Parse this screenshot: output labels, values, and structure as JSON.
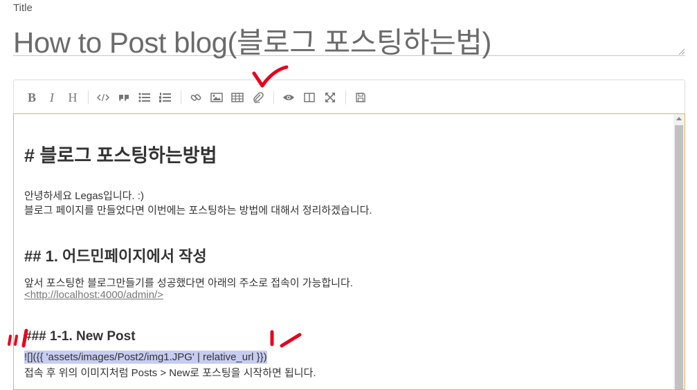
{
  "title_field": {
    "label": "Title",
    "value": "How to Post blog(블로그 포스팅하는법)"
  },
  "toolbar": {
    "buttons": [
      {
        "name": "bold",
        "icon": "bold-icon",
        "glyph": "B"
      },
      {
        "name": "italic",
        "icon": "italic-icon",
        "glyph": "I"
      },
      {
        "name": "heading",
        "icon": "heading-icon",
        "glyph": "H"
      },
      {
        "name": "code",
        "icon": "code-icon"
      },
      {
        "name": "quote",
        "icon": "quote-icon"
      },
      {
        "name": "unordered-list",
        "icon": "list-ul-icon"
      },
      {
        "name": "ordered-list",
        "icon": "list-ol-icon"
      },
      {
        "name": "link",
        "icon": "link-icon"
      },
      {
        "name": "image",
        "icon": "image-icon"
      },
      {
        "name": "table",
        "icon": "table-icon"
      },
      {
        "name": "attach",
        "icon": "paperclip-icon"
      },
      {
        "name": "preview",
        "icon": "eye-icon"
      },
      {
        "name": "side-by-side",
        "icon": "columns-icon"
      },
      {
        "name": "fullscreen",
        "icon": "expand-icon"
      },
      {
        "name": "save",
        "icon": "save-icon"
      }
    ]
  },
  "editor": {
    "heading1": "# 블로그 포스팅하는방법",
    "intro_line1": "안녕하세요 Legas입니다. :)",
    "intro_line2": "블로그 페이지를 만들었다면 이번에는 포스팅하는 방법에 대해서 정리하겠습니다.",
    "heading2": "## 1. 어드민페이지에서 작성",
    "section1_line1": "앞서 포스팅한 블로그만들기를 성공했다면 아래의 주소로 접속이 가능합니다.",
    "section1_link": "<http://localhost:4000/admin/>",
    "heading3": "### 1-1. New Post",
    "image_markdown": "![]({{ 'assets/images/Post2/img1.JPG' | relative_url }})",
    "section2_line1": "접속 후 위의 이미지처럼 Posts > New로 포스팅을 시작하면 됩니다."
  },
  "colors": {
    "editor_border": "#e0b45a",
    "selection": "#c7cdf0",
    "annotation_mark": "#e8001c"
  }
}
